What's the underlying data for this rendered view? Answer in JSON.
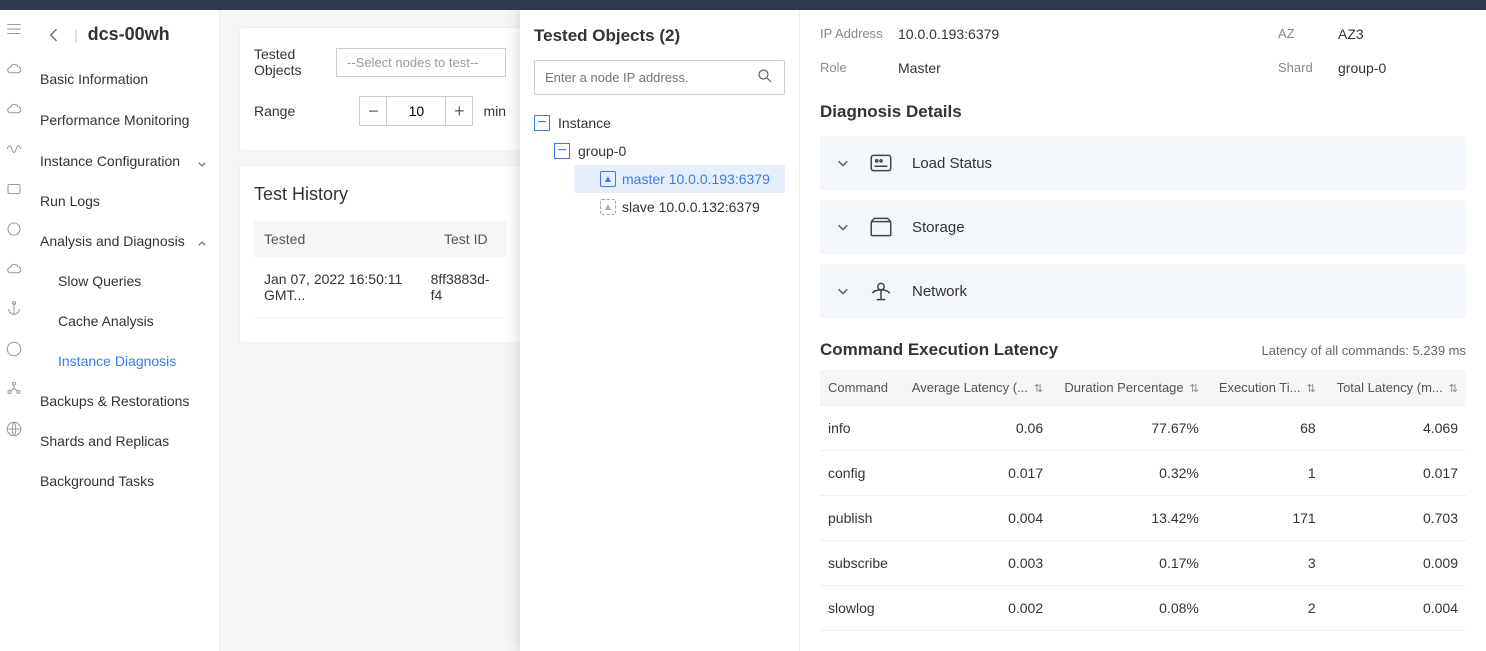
{
  "breadcrumb": {
    "title": "dcs-00wh"
  },
  "nav": {
    "items": [
      {
        "label": "Basic Information"
      },
      {
        "label": "Performance Monitoring"
      },
      {
        "label": "Instance Configuration",
        "caret": true
      },
      {
        "label": "Run Logs"
      },
      {
        "label": "Analysis and Diagnosis",
        "caret": true,
        "expanded": true,
        "children": [
          {
            "label": "Slow Queries"
          },
          {
            "label": "Cache Analysis"
          },
          {
            "label": "Instance Diagnosis",
            "active": true
          }
        ]
      },
      {
        "label": "Backups & Restorations"
      },
      {
        "label": "Shards and Replicas"
      },
      {
        "label": "Background Tasks"
      }
    ]
  },
  "form": {
    "tested_objects_label": "Tested Objects",
    "tested_objects_placeholder": "--Select nodes to test--",
    "range_label": "Range",
    "range_value": "10",
    "range_unit": "min"
  },
  "history": {
    "title": "Test History",
    "columns": [
      "Tested",
      "Test ID"
    ],
    "rows": [
      {
        "tested": "Jan 07, 2022 16:50:11 GMT...",
        "id": "8ff3883d-f4"
      }
    ]
  },
  "tree": {
    "title": "Tested Objects (2)",
    "search_placeholder": "Enter a node IP address.",
    "root": "Instance",
    "group": "group-0",
    "master": "master 10.0.0.193:6379",
    "slave": "slave 10.0.0.132:6379"
  },
  "info": {
    "ip_label": "IP Address",
    "ip": "10.0.0.193:6379",
    "az_label": "AZ",
    "az": "AZ3",
    "role_label": "Role",
    "role": "Master",
    "shard_label": "Shard",
    "shard": "group-0"
  },
  "diag": {
    "title": "Diagnosis Details",
    "sections": [
      "Load Status",
      "Storage",
      "Network"
    ]
  },
  "latency": {
    "title": "Command Execution Latency",
    "summary": "Latency of all commands: 5.239 ms",
    "columns": [
      "Command",
      "Average Latency (...",
      "Duration Percentage",
      "Execution Ti...",
      "Total Latency (m..."
    ],
    "rows": [
      {
        "cmd": "info",
        "avg": "0.06",
        "pct": "77.67%",
        "exec": "68",
        "total": "4.069"
      },
      {
        "cmd": "config",
        "avg": "0.017",
        "pct": "0.32%",
        "exec": "1",
        "total": "0.017"
      },
      {
        "cmd": "publish",
        "avg": "0.004",
        "pct": "13.42%",
        "exec": "171",
        "total": "0.703"
      },
      {
        "cmd": "subscribe",
        "avg": "0.003",
        "pct": "0.17%",
        "exec": "3",
        "total": "0.009"
      },
      {
        "cmd": "slowlog",
        "avg": "0.002",
        "pct": "0.08%",
        "exec": "2",
        "total": "0.004"
      }
    ]
  }
}
